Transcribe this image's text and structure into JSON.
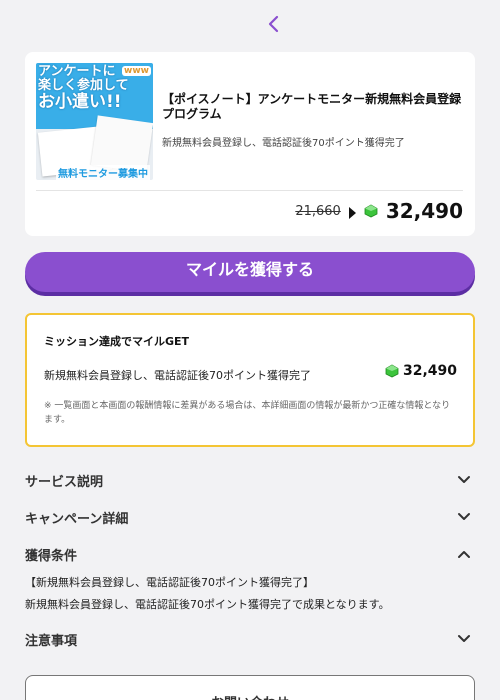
{
  "header": {
    "back_icon": "chevron-left-icon",
    "accent": "#8a4fcf"
  },
  "offer": {
    "banner": {
      "line1": "アンケートに",
      "line2": "楽しく参加して",
      "line3": "お小遣い!!",
      "tagline": "無料モニター募集中"
    },
    "title": "【ポイスノート】アンケートモニター新規無料会員登録プログラム",
    "description": "新規無料会員登録し、電話認証後70ポイント獲得完了",
    "old_price": "21,660",
    "new_price": "32,490",
    "gem_color": "#3cc43c"
  },
  "cta": {
    "label": "マイルを獲得する",
    "color": "#8a4fcf"
  },
  "mission": {
    "heading": "ミッション達成でマイルGET",
    "line": "新規無料会員登録し、電話認証後70ポイント獲得完了",
    "points": "32,490",
    "note": "※ 一覧画面と本画面の報酬情報に差異がある場合は、本詳細画面の情報が最新かつ正確な情報となります。",
    "border_color": "#f4c534"
  },
  "accordions": [
    {
      "label": "サービス説明",
      "expanded": false
    },
    {
      "label": "キャンペーン詳細",
      "expanded": false
    },
    {
      "label": "獲得条件",
      "expanded": true
    },
    {
      "label": "注意事項",
      "expanded": false
    }
  ],
  "conditions": {
    "line1": "【新規無料会員登録し、電話認証後70ポイント獲得完了】",
    "line2": "新規無料会員登録し、電話認証後70ポイント獲得完了で成果となります。"
  },
  "contact": {
    "label": "お問い合わせ"
  }
}
